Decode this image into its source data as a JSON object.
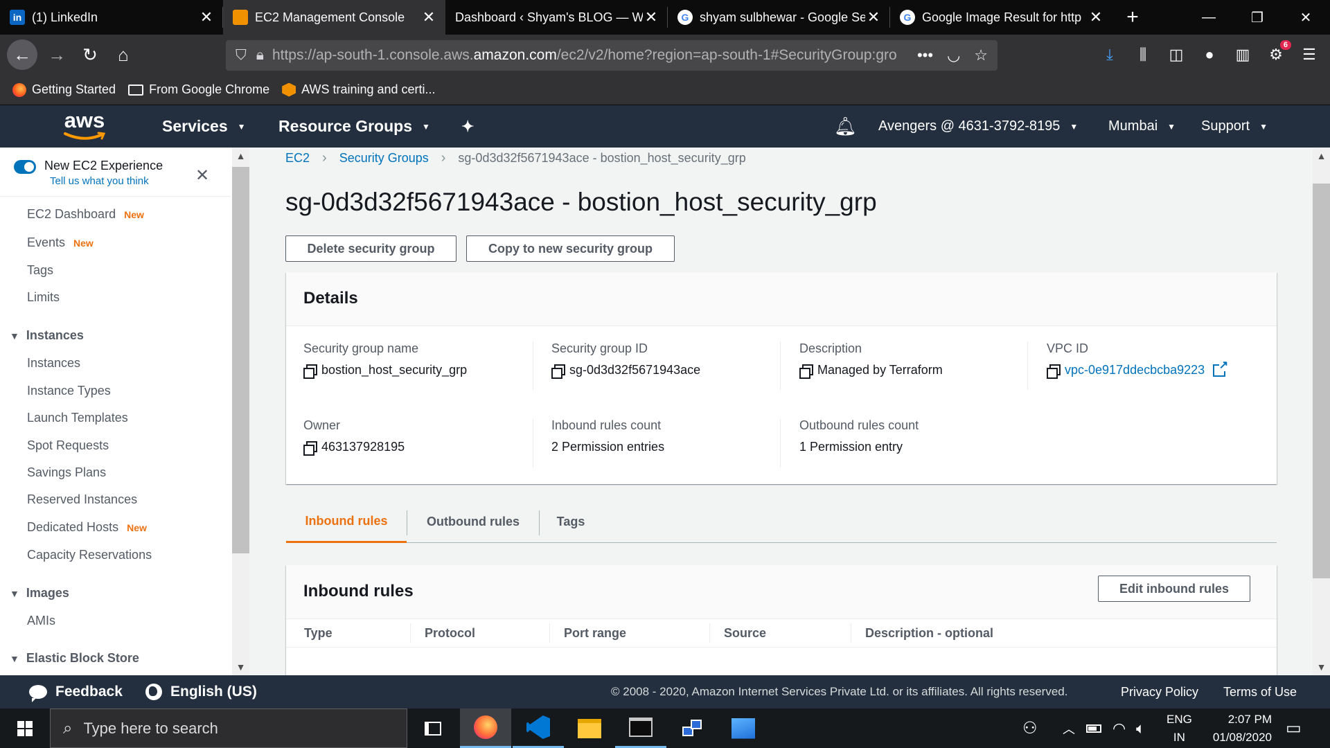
{
  "browser": {
    "tabs": [
      {
        "title": "(1) LinkedIn",
        "icon": "linkedin-icon",
        "active": false
      },
      {
        "title": "EC2 Management Console",
        "icon": "aws-icon",
        "active": true
      },
      {
        "title": "Dashboard ‹ Shyam's BLOG — W",
        "icon": "wordpress-icon",
        "active": false
      },
      {
        "title": "shyam sulbhewar - Google Se",
        "icon": "google-icon",
        "active": false
      },
      {
        "title": "Google Image Result for http",
        "icon": "google-icon",
        "active": false
      }
    ],
    "url_prefix": "https://ap-south-1.console.aws.",
    "url_domain": "amazon.com",
    "url_suffix": "/ec2/v2/home?region=ap-south-1#SecurityGroup:gro",
    "url_more": "•••",
    "notification_badge": "6",
    "bookmarks": [
      {
        "label": "Getting Started",
        "icon": "firefox-icon"
      },
      {
        "label": "From Google Chrome",
        "icon": "folder-icon"
      },
      {
        "label": "AWS training and certi...",
        "icon": "aws-cube-icon"
      }
    ]
  },
  "aws_header": {
    "logo": "aws",
    "services": "Services",
    "resource_groups": "Resource Groups",
    "account": "Avengers @ 4631-3792-8195",
    "region": "Mumbai",
    "support": "Support"
  },
  "sidebar": {
    "experience_title": "New EC2 Experience",
    "experience_sub": "Tell us what you think",
    "new_badge": "New",
    "top_items": [
      {
        "label": "EC2 Dashboard",
        "new": true
      },
      {
        "label": "Events",
        "new": true
      },
      {
        "label": "Tags",
        "new": false
      },
      {
        "label": "Limits",
        "new": false
      }
    ],
    "instances_section": "Instances",
    "instances_items": [
      {
        "label": "Instances",
        "new": false
      },
      {
        "label": "Instance Types",
        "new": false
      },
      {
        "label": "Launch Templates",
        "new": false
      },
      {
        "label": "Spot Requests",
        "new": false
      },
      {
        "label": "Savings Plans",
        "new": false
      },
      {
        "label": "Reserved Instances",
        "new": false
      },
      {
        "label": "Dedicated Hosts",
        "new": true
      },
      {
        "label": "Capacity Reservations",
        "new": false
      }
    ],
    "images_section": "Images",
    "images_items": [
      {
        "label": "AMIs"
      }
    ],
    "ebs_section": "Elastic Block Store"
  },
  "main": {
    "breadcrumb": [
      "EC2",
      "Security Groups",
      "sg-0d3d32f5671943ace - bostion_host_security_grp"
    ],
    "title": "sg-0d3d32f5671943ace - bostion_host_security_grp",
    "delete_button": "Delete security group",
    "copy_button": "Copy to new security group",
    "details": {
      "heading": "Details",
      "fields": [
        {
          "label": "Security group name",
          "value": "bostion_host_security_grp",
          "copy": true,
          "link": false
        },
        {
          "label": "Security group ID",
          "value": "sg-0d3d32f5671943ace",
          "copy": true,
          "link": false
        },
        {
          "label": "Description",
          "value": "Managed by Terraform",
          "copy": true,
          "link": false
        },
        {
          "label": "VPC ID",
          "value": "vpc-0e917ddecbcba9223",
          "copy": true,
          "link": true
        },
        {
          "label": "Owner",
          "value": "463137928195",
          "copy": true,
          "link": false
        },
        {
          "label": "Inbound rules count",
          "value": "2 Permission entries",
          "copy": false,
          "link": false
        },
        {
          "label": "Outbound rules count",
          "value": "1 Permission entry",
          "copy": false,
          "link": false
        }
      ]
    },
    "tabs": [
      "Inbound rules",
      "Outbound rules",
      "Tags"
    ],
    "inbound": {
      "heading": "Inbound rules",
      "edit_button": "Edit inbound rules",
      "columns": [
        "Type",
        "Protocol",
        "Port range",
        "Source",
        "Description - optional"
      ]
    }
  },
  "footer": {
    "feedback": "Feedback",
    "language": "English (US)",
    "copyright": "© 2008 - 2020, Amazon Internet Services Private Ltd. or its affiliates. All rights reserved.",
    "privacy": "Privacy Policy",
    "terms": "Terms of Use"
  },
  "taskbar": {
    "search_placeholder": "Type here to search",
    "lang_top": "ENG",
    "lang_bottom": "IN",
    "time": "2:07 PM",
    "date": "01/08/2020"
  },
  "colors": {
    "aws_nav": "#232f3e",
    "accent_orange": "#ec7211",
    "link_blue": "#0073bb",
    "browser_dark": "#0c0c0d"
  }
}
